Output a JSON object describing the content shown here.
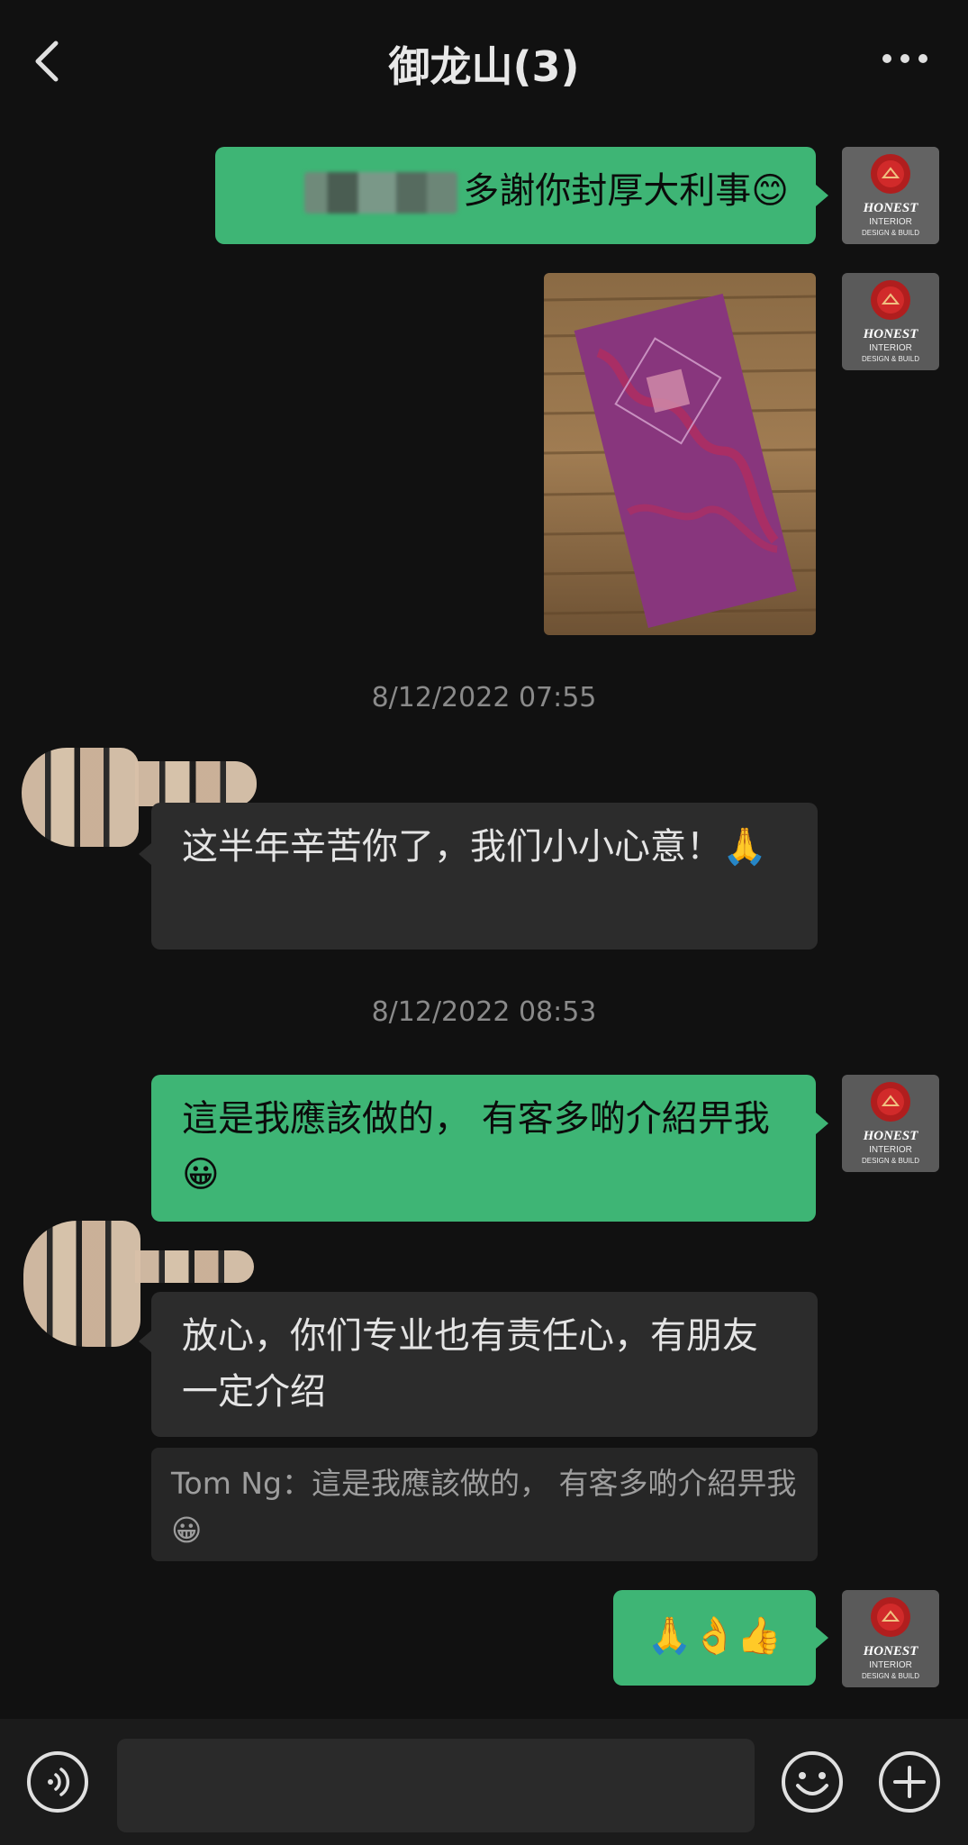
{
  "header": {
    "title": "御龙山(3)",
    "back_icon": "chevron-left-icon",
    "more_icon": "more-dots-icon"
  },
  "messages": {
    "m1": {
      "text": "多謝你封厚大利事😊"
    },
    "ts1": "8/12/2022 07:55",
    "m3": {
      "text": "这半年辛苦你了，我们小小心意！🙏"
    },
    "ts2": "8/12/2022 08:53",
    "m4": {
      "text": "這是我應該做的， 有客多啲介紹畀我😀"
    },
    "m5": {
      "text": "放心，你们专业也有责任心，有朋友一定介绍",
      "quote": "Tom Ng：這是我應該做的， 有客多啲介紹畀我😀"
    },
    "m6": {
      "text": "🙏👌👍"
    }
  },
  "avatar_logo": {
    "brand": "HONEST",
    "line1": "INTERIOR",
    "line2": "DESIGN & BUILD"
  },
  "composer": {
    "voice_icon": "voice-icon",
    "emoji_icon": "emoji-icon",
    "plus_icon": "plus-icon",
    "input_value": ""
  },
  "colors": {
    "background": "#111111",
    "bubble_self": "#3eb575",
    "bubble_other": "#2c2c2c",
    "timestamp": "#8a8a8a"
  }
}
